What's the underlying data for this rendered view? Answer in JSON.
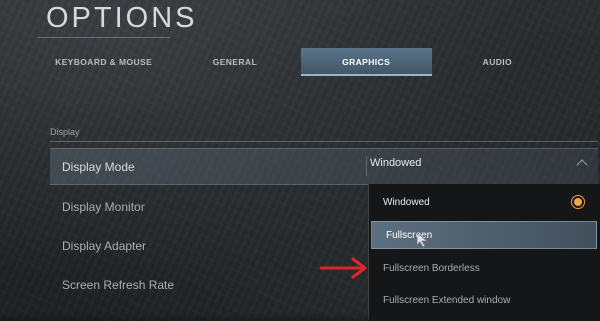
{
  "page": {
    "title": "OPTIONS"
  },
  "tabs": [
    {
      "label": "KEYBOARD & MOUSE",
      "active": false
    },
    {
      "label": "GENERAL",
      "active": false
    },
    {
      "label": "GRAPHICS",
      "active": true
    },
    {
      "label": "AUDIO",
      "active": false
    }
  ],
  "section": {
    "label": "Display"
  },
  "settings": [
    {
      "label": "Display Mode",
      "value": "Windowed",
      "selected": true
    },
    {
      "label": "Display Monitor"
    },
    {
      "label": "Display Adapter"
    },
    {
      "label": "Screen Refresh Rate"
    }
  ],
  "dropdown": {
    "options": [
      {
        "label": "Windowed",
        "checked": true
      },
      {
        "label": "Fullscreen",
        "hovered": true
      },
      {
        "label": "Fullscreen Borderless"
      },
      {
        "label": "Fullscreen Extended window"
      }
    ]
  },
  "colors": {
    "accent_tab": "#4f687c",
    "radio_orange": "#f2a548",
    "annotation_arrow": "#e0242b",
    "background": "#25282a"
  },
  "icons": {
    "chevron": "chevron-up-icon",
    "radio": "radio-selected-icon",
    "cursor": "mouse-cursor-icon",
    "annotation": "red-arrow-icon"
  }
}
